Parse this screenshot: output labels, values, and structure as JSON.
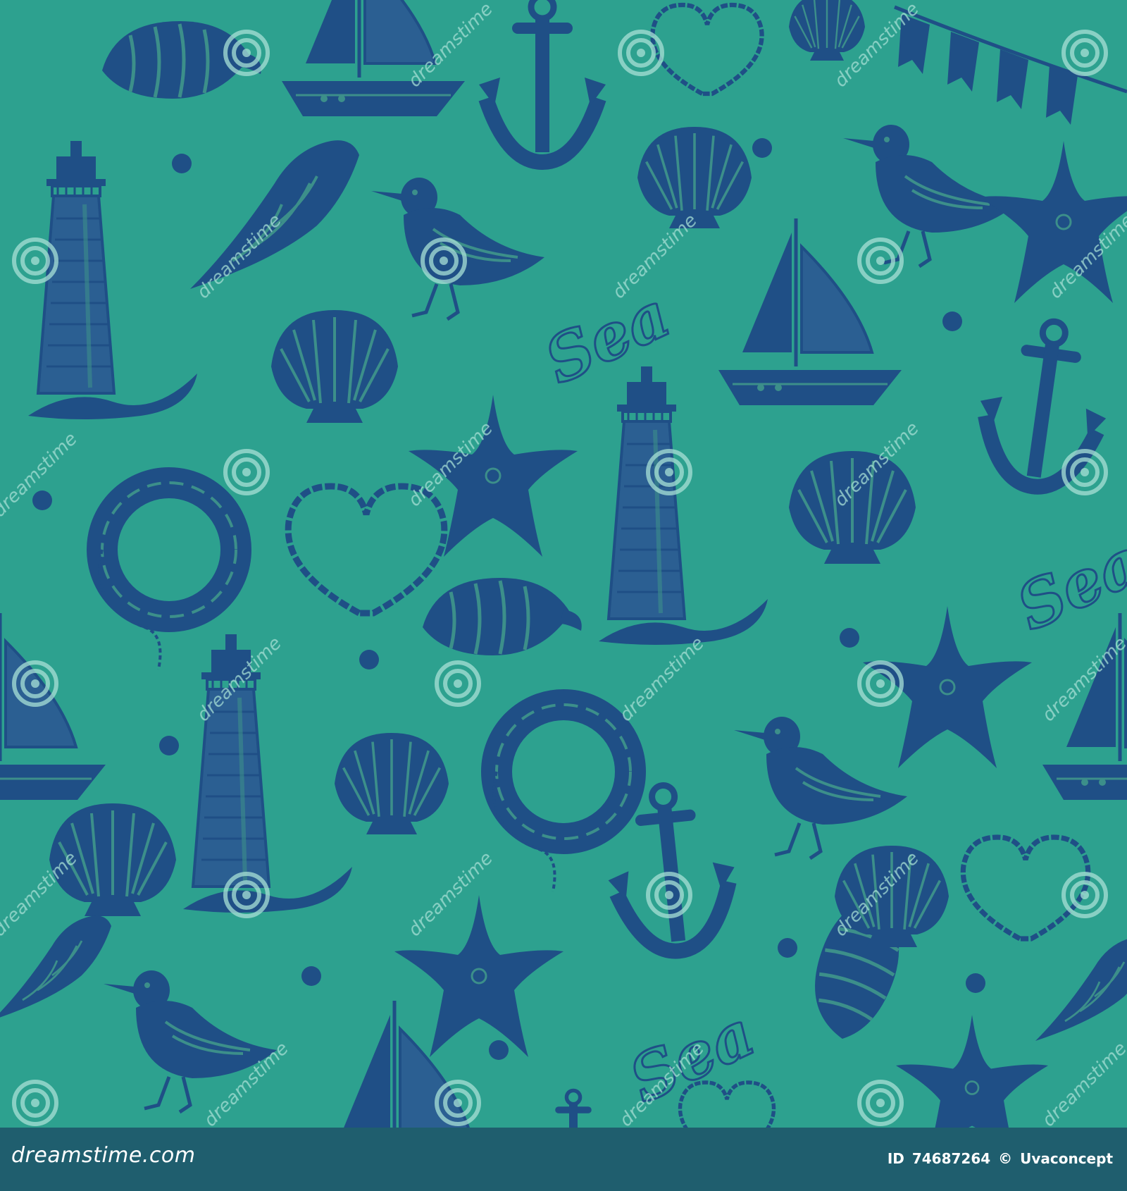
{
  "colors": {
    "background": "#2da18f",
    "ink": "#1f4f86",
    "ink_light": "#3c6fa0",
    "footer_bg": "#1f5e6e",
    "footer_text": "#ffffff",
    "watermark": "#a8e0d6"
  },
  "pattern": {
    "word": "Sea",
    "watermark_text": "dreamstime",
    "motifs": [
      "lighthouse-icon",
      "sailboat-icon",
      "anchor-icon",
      "seashell-icon",
      "scallop-icon",
      "conch-icon",
      "seagull-icon",
      "starfish-icon",
      "lifebuoy-icon",
      "rope-heart-icon",
      "bunting-icon",
      "pearl-icon"
    ]
  },
  "footer": {
    "site": "dreamstime.com",
    "id_label": "ID",
    "id_value": "74687264",
    "copyright_symbol": "©",
    "author": "Uvaconcept"
  }
}
